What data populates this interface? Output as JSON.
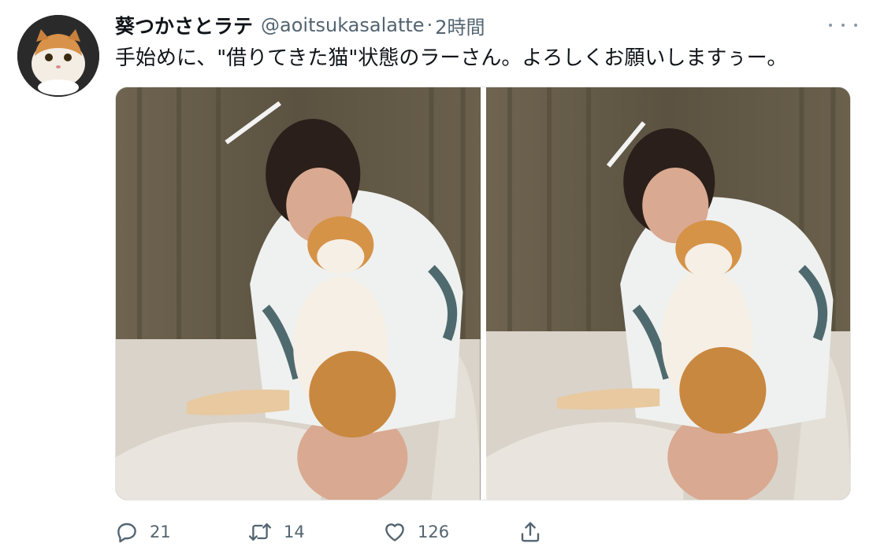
{
  "author": {
    "display_name": "葵つかさとラテ",
    "handle": "@aoitsukasalatte",
    "separator": "·",
    "time": "2時間"
  },
  "tweet": {
    "text": "手始めに、\"借りてきた猫\"状態のラーさん。よろしくお願いしますぅー。"
  },
  "media": {
    "count": 2
  },
  "actions": {
    "reply": {
      "icon": "reply-icon",
      "count": "21"
    },
    "retweet": {
      "icon": "retweet-icon",
      "count": "14"
    },
    "like": {
      "icon": "heart-icon",
      "count": "126"
    },
    "share": {
      "icon": "share-icon"
    }
  },
  "colors": {
    "text_primary": "#0f1419",
    "text_secondary": "#536471",
    "icon": "#536471"
  }
}
